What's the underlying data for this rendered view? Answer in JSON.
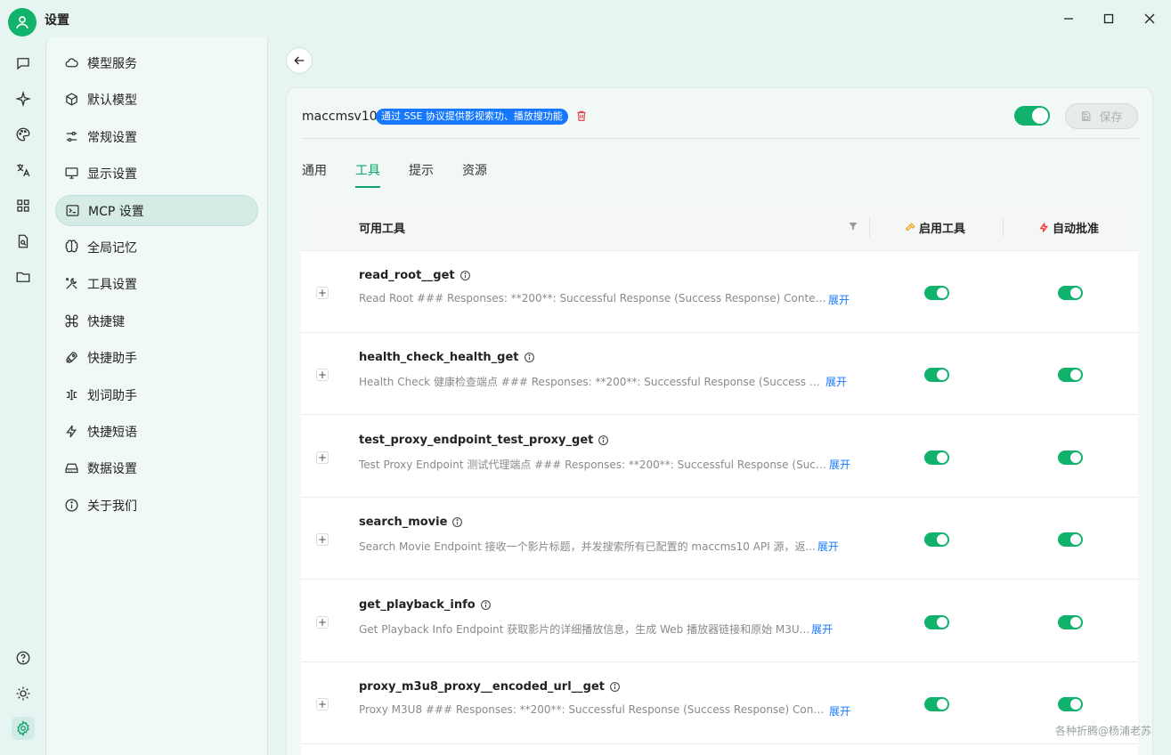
{
  "window": {
    "title": "设置"
  },
  "nav": {
    "items": [
      {
        "label": "模型服务",
        "icon": "cloud-icon"
      },
      {
        "label": "默认模型",
        "icon": "cube-icon"
      },
      {
        "label": "常规设置",
        "icon": "sliders-icon"
      },
      {
        "label": "显示设置",
        "icon": "monitor-icon"
      },
      {
        "label": "MCP 设置",
        "icon": "terminal-icon",
        "active": true
      },
      {
        "label": "全局记忆",
        "icon": "brain-icon"
      },
      {
        "label": "工具设置",
        "icon": "tools-icon"
      },
      {
        "label": "快捷键",
        "icon": "command-icon"
      },
      {
        "label": "快捷助手",
        "icon": "rocket-icon"
      },
      {
        "label": "划词助手",
        "icon": "text-cursor-icon"
      },
      {
        "label": "快捷短语",
        "icon": "zap-icon"
      },
      {
        "label": "数据设置",
        "icon": "hard-drive-icon"
      },
      {
        "label": "关于我们",
        "icon": "info-icon"
      }
    ]
  },
  "server": {
    "name": "maccmsv10",
    "tag": "通过 SSE 协议提供影视索功、播放搜功能",
    "save_label": "保存",
    "enabled": true
  },
  "tabs": [
    {
      "label": "通用"
    },
    {
      "label": "工具",
      "active": true
    },
    {
      "label": "提示"
    },
    {
      "label": "资源"
    }
  ],
  "table": {
    "col_tools": "可用工具",
    "col_enable": "启用工具",
    "col_auto": "自动批准",
    "expand_label": "展开",
    "rows": [
      {
        "name": "read_root__get",
        "desc": "Read Root ### Responses: **200**: Successful Response (Success Response) Content-T...",
        "enabled": true,
        "auto": true
      },
      {
        "name": "health_check_health_get",
        "desc": "Health Check 健康检查端点 ### Responses: **200**: Successful Response (Success Res...",
        "enabled": true,
        "auto": true
      },
      {
        "name": "test_proxy_endpoint_test_proxy_get",
        "desc": "Test Proxy Endpoint 测试代理端点 ### Responses: **200**: Successful Response (Succe...",
        "enabled": true,
        "auto": true
      },
      {
        "name": "search_movie",
        "desc": "Search Movie Endpoint 接收一个影片标题，并发搜索所有已配置的 maccms10 API 源，返...",
        "enabled": true,
        "auto": true
      },
      {
        "name": "get_playback_info",
        "desc": "Get Playback Info Endpoint 获取影片的详细播放信息，生成 Web 播放器链接和原始 M3U...",
        "enabled": true,
        "auto": true
      },
      {
        "name": "proxy_m3u8_proxy__encoded_url__get",
        "desc": "Proxy M3U8 ### Responses: **200**: Successful Response (Success Response) Content...",
        "enabled": true,
        "auto": true
      }
    ]
  },
  "watermark": "各种折腾@杨浦老苏"
}
